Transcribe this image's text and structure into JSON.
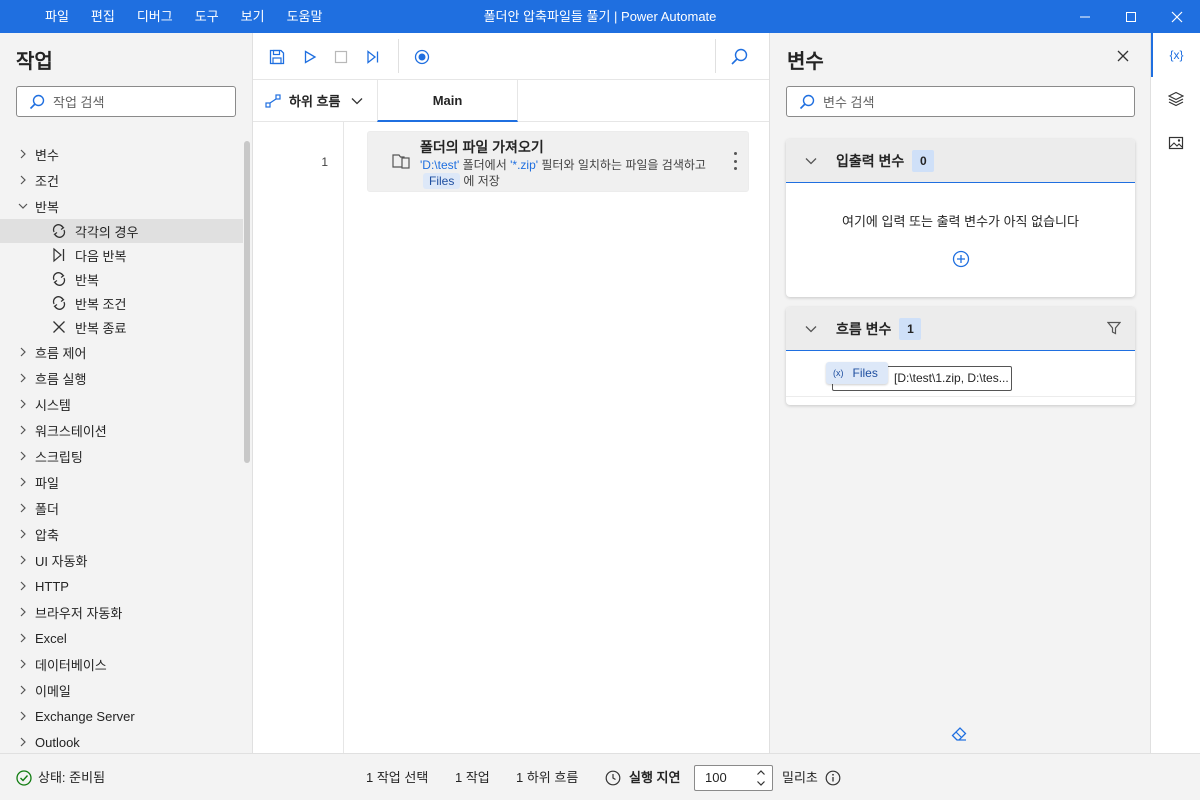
{
  "titlebar": {
    "menu": [
      "파일",
      "편집",
      "디버그",
      "도구",
      "보기",
      "도움말"
    ],
    "title": "폴더안 압축파일들 풀기 | Power Automate"
  },
  "actions_pane": {
    "title": "작업",
    "search_placeholder": "작업 검색",
    "groups_top": [
      {
        "label": "변수",
        "expanded": false
      },
      {
        "label": "조건",
        "expanded": false
      },
      {
        "label": "반복",
        "expanded": true
      }
    ],
    "loop_children": [
      {
        "label": "각각의 경우",
        "icon": "loop-icon",
        "selected": true
      },
      {
        "label": "다음 반복",
        "icon": "next-loop-icon",
        "selected": false
      },
      {
        "label": "반복",
        "icon": "loop-icon",
        "selected": false
      },
      {
        "label": "반복 조건",
        "icon": "loop-icon",
        "selected": false
      },
      {
        "label": "반복 종료",
        "icon": "close-icon",
        "selected": false
      }
    ],
    "groups_bottom": [
      "흐름 제어",
      "흐름 실행",
      "시스템",
      "워크스테이션",
      "스크립팅",
      "파일",
      "폴더",
      "압축",
      "UI 자동화",
      "HTTP",
      "브라우저 자동화",
      "Excel",
      "데이터베이스",
      "이메일",
      "Exchange Server",
      "Outlook"
    ]
  },
  "designer": {
    "subflow_label": "하위 흐름",
    "tab_main": "Main",
    "action": {
      "line": "1",
      "title": "폴더의 파일 가져오기",
      "desc_folder": "'D:\\test'",
      "desc_mid": " 폴더에서 ",
      "desc_filter": "'*.zip'",
      "desc_rest": " 필터와 일치하는 파일을 검색하고",
      "desc_var": "Files",
      "desc_end": "에 저장"
    }
  },
  "variables_pane": {
    "title": "변수",
    "search_placeholder": "변수 검색",
    "io_section": {
      "title": "입출력 변수",
      "count": "0",
      "empty_message": "여기에 입력 또는 출력 변수가 아직 없습니다"
    },
    "flow_section": {
      "title": "흐름 변수",
      "count": "1",
      "var_chip": "Files",
      "var_chip_prefix": "(x)",
      "var_value": "[D:\\test\\1.zip, D:\\tes..."
    }
  },
  "rail": {
    "variables_label": "{x}"
  },
  "statusbar": {
    "status": "상태: 준비됨",
    "selected": "1 작업 선택",
    "actions": "1 작업",
    "subflows": "1 하위 흐름",
    "delay_label": "실행 지연",
    "delay_value": "100",
    "delay_unit": "밀리초"
  },
  "colors": {
    "accent": "#1f6fe0",
    "pane_bg": "#f3f3f3"
  }
}
